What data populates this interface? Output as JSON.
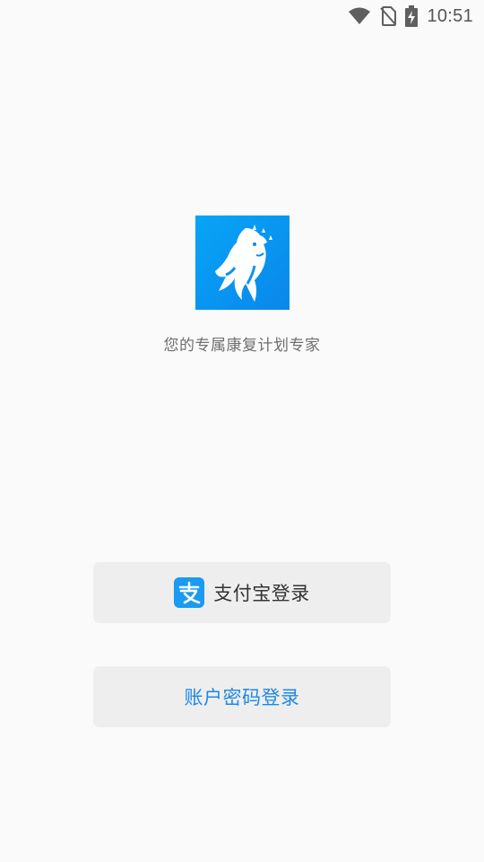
{
  "status_bar": {
    "time": "10:51",
    "icons": [
      "wifi-icon",
      "no-sim-icon",
      "battery-charging-icon"
    ]
  },
  "app": {
    "logo_icon": "horse-logo-icon",
    "tagline": "您的专属康复计划专家"
  },
  "login": {
    "alipay_label": "支付宝登录",
    "alipay_icon": "alipay-icon",
    "account_label": "账户密码登录"
  },
  "colors": {
    "background": "#fafafa",
    "logo_blue": "#1296f3",
    "alipay_blue": "#1a9bef",
    "link_blue": "#1e88e5",
    "button_bg": "#eeeeee"
  }
}
